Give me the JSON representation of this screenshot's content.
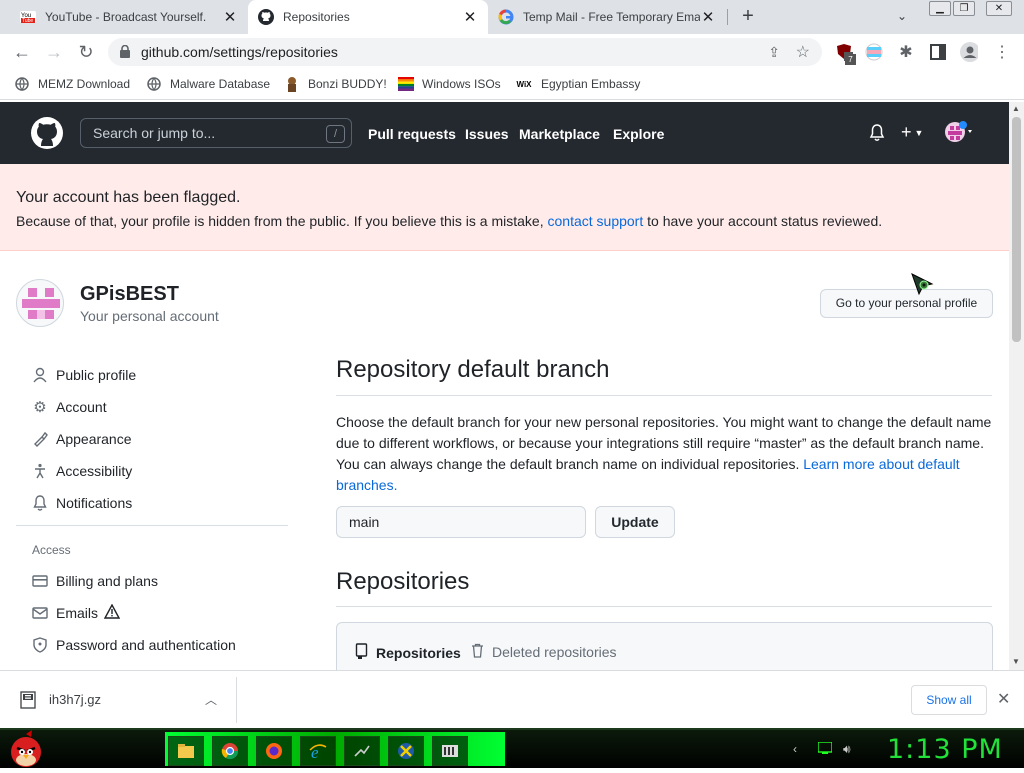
{
  "browser": {
    "tabs": [
      {
        "title": "YouTube - Broadcast Yourself.",
        "icon": "youtube-icon",
        "active": false
      },
      {
        "title": "Repositories",
        "icon": "github-icon",
        "active": true
      },
      {
        "title": "Temp Mail - Free Temporary Email",
        "icon": "google-icon",
        "active": false
      }
    ],
    "new_tab": "+",
    "address": "github.com/settings/repositories",
    "extension_badge": "7",
    "bookmarks": [
      {
        "label": "MEMZ Download",
        "icon": "globe-icon"
      },
      {
        "label": "Malware Database",
        "icon": "globe-icon"
      },
      {
        "label": "Bonzi BUDDY!",
        "icon": "bonzi-icon"
      },
      {
        "label": "Windows ISOs",
        "icon": "rainbow-flag-icon"
      },
      {
        "label": "Egyptian Embassy",
        "icon": "wix-icon"
      }
    ],
    "bookmark_wix_glyph": "WiX"
  },
  "github": {
    "search_placeholder": "Search or jump to...",
    "search_shortcut": "/",
    "nav": [
      "Pull requests",
      "Issues",
      "Marketplace",
      "Explore"
    ],
    "flag_title": "Your account has been flagged.",
    "flag_msg_before": "Because of that, your profile is hidden from the public. If you believe this is a mistake, ",
    "flag_link": "contact support",
    "flag_msg_after": " to have your account status reviewed.",
    "username": "GPisBEST",
    "account_type": "Your personal account",
    "profile_button": "Go to your personal profile",
    "side_menu": [
      {
        "label": "Public profile",
        "icon": "person-icon"
      },
      {
        "label": "Account",
        "icon": "gear-icon"
      },
      {
        "label": "Appearance",
        "icon": "paintbrush-icon"
      },
      {
        "label": "Accessibility",
        "icon": "accessibility-icon"
      },
      {
        "label": "Notifications",
        "icon": "bell-icon"
      }
    ],
    "access_heading": "Access",
    "access_menu": [
      {
        "label": "Billing and plans",
        "icon": "credit-card-icon"
      },
      {
        "label": "Emails",
        "icon": "mail-icon"
      },
      {
        "label": "Password and authentication",
        "icon": "shield-icon"
      }
    ],
    "default_branch_title": "Repository default branch",
    "default_branch_desc": "Choose the default branch for your new personal repositories. You might want to change the default name due to different workflows, or because your integrations still require “master” as the default branch name. You can always change the default branch name on individual repositories. ",
    "default_branch_link": "Learn more about default branches.",
    "branch_value": "main",
    "update_button": "Update",
    "repositories_title": "Repositories",
    "repo_tabs": [
      "Repositories",
      "Deleted repositories"
    ]
  },
  "download": {
    "filename": "ih3h7j.gz",
    "show_all": "Show all"
  },
  "taskbar": {
    "clock": "1:13 PM"
  }
}
